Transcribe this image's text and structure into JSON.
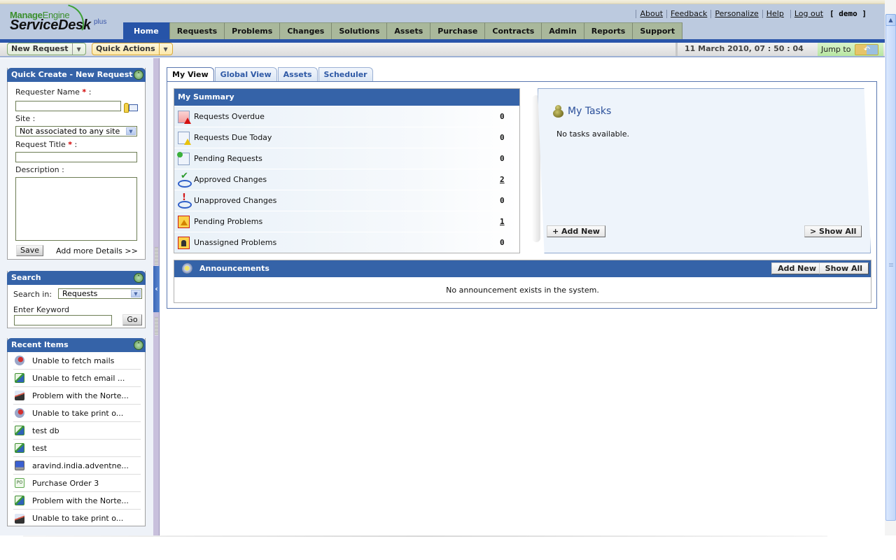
{
  "app": {
    "brand_top": "Manage",
    "brand_top_light": "Engine",
    "brand_main": "ServiceDesk",
    "brand_suffix": "plus"
  },
  "toplinks": {
    "about": "About",
    "feedback": "Feedback",
    "personalize": "Personalize",
    "help": "Help",
    "logout": "Log out",
    "user": "[ demo ]"
  },
  "nav": {
    "tabs": [
      "Home",
      "Requests",
      "Problems",
      "Changes",
      "Solutions",
      "Assets",
      "Purchase",
      "Contracts",
      "Admin",
      "Reports",
      "Support"
    ],
    "active": "Home"
  },
  "toolbar": {
    "new_request": "New Request",
    "quick_actions": "Quick Actions",
    "datetime": "11 March 2010, 07 : 50 : 04",
    "jump_to": "Jump to"
  },
  "quick_create": {
    "title": "Quick Create - New Request",
    "requester_label": "Requester Name",
    "requester_value": "",
    "site_label": "Site :",
    "site_value": "Not associated to any site",
    "title_label": "Request Title",
    "title_value": "",
    "description_label": "Description :",
    "description_value": "",
    "required_mark": "*",
    "colon": ":",
    "save": "Save",
    "add_more": "Add more Details >>"
  },
  "search": {
    "title": "Search",
    "search_in_label": "Search in:",
    "search_in_value": "Requests",
    "keyword_label": "Enter Keyword",
    "keyword_value": "",
    "go": "Go"
  },
  "recent": {
    "title": "Recent Items",
    "items": [
      {
        "label": "Unable to fetch mails",
        "icon": "problem-icon"
      },
      {
        "label": "Unable to fetch email ...",
        "icon": "request-icon"
      },
      {
        "label": "Problem with the Norte...",
        "icon": "change-icon"
      },
      {
        "label": "Unable to take print o...",
        "icon": "problem-icon"
      },
      {
        "label": "test db",
        "icon": "request-icon"
      },
      {
        "label": "test",
        "icon": "request-icon"
      },
      {
        "label": "aravind.india.adventne...",
        "icon": "asset-icon"
      },
      {
        "label": "Purchase Order 3",
        "icon": "purchase-order-icon"
      },
      {
        "label": "Problem with the Norte...",
        "icon": "request-icon"
      },
      {
        "label": "Unable to take print o...",
        "icon": "change-icon"
      }
    ]
  },
  "view_tabs": {
    "tabs": [
      "My View",
      "Global View",
      "Assets",
      "Scheduler"
    ],
    "active": "My View"
  },
  "summary": {
    "title": "My Summary",
    "rows": [
      {
        "label": "Requests Overdue",
        "value": "0",
        "link": false,
        "icon": "requests-overdue-icon"
      },
      {
        "label": "Requests Due Today",
        "value": "0",
        "link": false,
        "icon": "requests-due-today-icon"
      },
      {
        "label": "Pending Requests",
        "value": "0",
        "link": false,
        "icon": "pending-requests-icon"
      },
      {
        "label": "Approved Changes",
        "value": "2",
        "link": true,
        "icon": "approved-changes-icon"
      },
      {
        "label": "Unapproved Changes",
        "value": "0",
        "link": false,
        "icon": "unapproved-changes-icon"
      },
      {
        "label": "Pending Problems",
        "value": "1",
        "link": true,
        "icon": "pending-problems-icon"
      },
      {
        "label": "Unassigned Problems",
        "value": "0",
        "link": false,
        "icon": "unassigned-problems-icon"
      }
    ]
  },
  "tasks": {
    "title": "My Tasks",
    "empty": "No tasks available.",
    "add_new": "+ Add New",
    "show_all": "> Show All"
  },
  "announcements": {
    "title": "Announcements",
    "add_new": "Add New",
    "show_all": "Show All",
    "empty": "No announcement exists in the system."
  },
  "colors": {
    "header_bg": "#bccadf",
    "nav_active": "#2754a8",
    "nav_tab": "#a9b89b",
    "panel_head": "#3563a8"
  }
}
